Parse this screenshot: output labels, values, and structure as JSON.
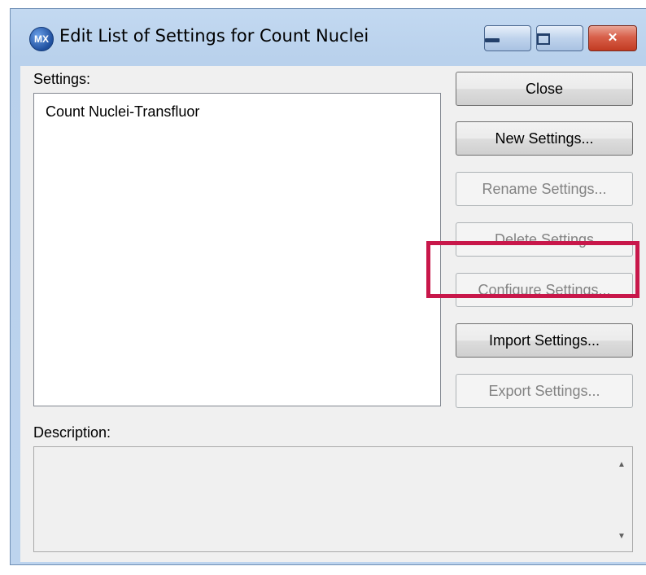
{
  "window": {
    "title": "Edit List of Settings for Count Nuclei",
    "app_icon_text": "MX",
    "controls": {
      "minimize": "minimize",
      "maximize": "maximize",
      "close": "✕"
    }
  },
  "settings": {
    "label": "Settings:",
    "items": [
      "Count Nuclei-Transfluor"
    ]
  },
  "buttons": {
    "close": "Close",
    "new": "New Settings...",
    "rename": "Rename Settings...",
    "delete": "Delete Settings",
    "configure": "Configure Settings...",
    "import": "Import Settings...",
    "export": "Export Settings..."
  },
  "description": {
    "label": "Description:",
    "value": ""
  },
  "colors": {
    "highlight": "#c8174a",
    "title_bar": "#bdd4ee"
  }
}
